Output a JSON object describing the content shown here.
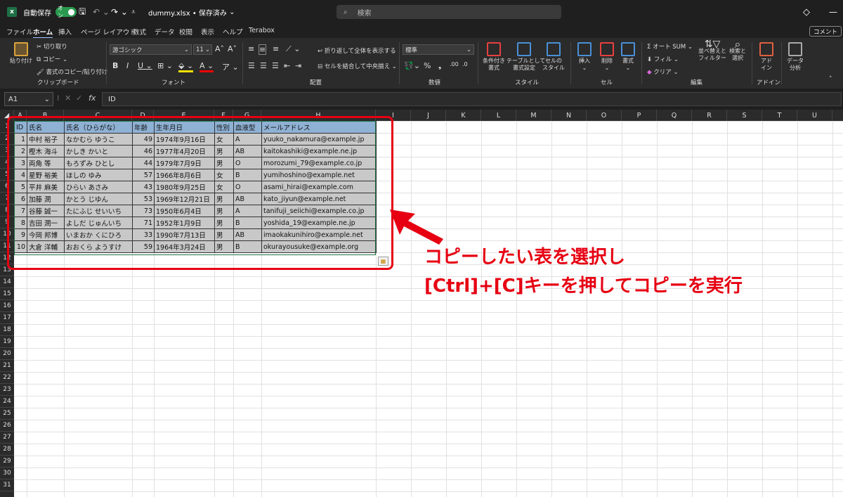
{
  "titlebar": {
    "autosave_label": "自動保存",
    "toggle_label": "オン",
    "file_name": "dummy.xlsx • 保存済み",
    "search_placeholder": "検索"
  },
  "tabs": [
    "ファイル",
    "ホーム",
    "挿入",
    "ページ レイアウト",
    "数式",
    "データ",
    "校閲",
    "表示",
    "ヘルプ",
    "Terabox"
  ],
  "share_label": "コメント",
  "ribbon": {
    "clipboard": {
      "paste": "貼り付け",
      "cut": "切り取り",
      "copy": "コピー",
      "format_painter": "書式のコピー/貼り付け",
      "label": "クリップボード"
    },
    "font": {
      "name": "游ゴシック",
      "size": "11",
      "label": "フォント"
    },
    "alignment": {
      "wrap": "折り返して全体を表示する",
      "merge": "セルを結合して中央揃え",
      "label": "配置"
    },
    "number": {
      "format": "標準",
      "label": "数値"
    },
    "styles": {
      "conditional": "条件付き\n書式",
      "table": "テーブルとして\n書式設定",
      "cell": "セルの\nスタイル",
      "label": "スタイル"
    },
    "cells": {
      "insert": "挿入",
      "delete": "削除",
      "format": "書式",
      "label": "セル"
    },
    "editing": {
      "autosum": "オート SUM",
      "fill": "フィル",
      "clear": "クリア",
      "sort": "並べ替えと\nフィルター",
      "find": "検索と\n選択",
      "label": "編集"
    },
    "addins": {
      "addin": "アド\nイン",
      "label": "アドイン"
    },
    "analysis": {
      "data": "データ\n分析"
    }
  },
  "namebox": "A1",
  "formula": "ID",
  "columns": [
    "A",
    "B",
    "C",
    "D",
    "E",
    "F",
    "G",
    "H",
    "I",
    "J",
    "K",
    "L",
    "M",
    "N",
    "O",
    "P",
    "Q",
    "R",
    "S",
    "T",
    "U"
  ],
  "table": {
    "headers": [
      "ID",
      "氏名",
      "氏名（ひらがな）",
      "年齢",
      "生年月日",
      "性別",
      "血液型",
      "メールアドレス"
    ],
    "rows": [
      [
        "1",
        "中村 裕子",
        "なかむら ゆうこ",
        "49",
        "1974年9月16日",
        "女",
        "A",
        "yuuko_nakamura@example.jp"
      ],
      [
        "2",
        "樫木 海斗",
        "かしき かいと",
        "46",
        "1977年4月20日",
        "男",
        "AB",
        "kaitokashiki@example.ne.jp"
      ],
      [
        "3",
        "両角 等",
        "もろずみ ひとし",
        "44",
        "1979年7月9日",
        "男",
        "O",
        "morozumi_79@example.co.jp"
      ],
      [
        "4",
        "星野 裕美",
        "ほしの ゆみ",
        "57",
        "1966年8月6日",
        "女",
        "B",
        "yumihoshino@example.net"
      ],
      [
        "5",
        "平井 麻美",
        "ひらい あさみ",
        "43",
        "1980年9月25日",
        "女",
        "O",
        "asami_hirai@example.com"
      ],
      [
        "6",
        "加藤 潤",
        "かとう じゆん",
        "53",
        "1969年12月21日",
        "男",
        "AB",
        "kato_jiyun@example.net"
      ],
      [
        "7",
        "谷藤 誠一",
        "たにふじ せいいち",
        "73",
        "1950年6月4日",
        "男",
        "A",
        "tanifuji_seiichi@example.co.jp"
      ],
      [
        "8",
        "吉田 潤一",
        "よしだ じゅんいち",
        "71",
        "1952年1月9日",
        "男",
        "B",
        "yoshida_19@example.ne.jp"
      ],
      [
        "9",
        "今岡 邦博",
        "いまおか くにひろ",
        "33",
        "1990年7月13日",
        "男",
        "AB",
        "imaokakunihiro@example.net"
      ],
      [
        "10",
        "大倉 洋輔",
        "おおくら ようすけ",
        "59",
        "1964年3月24日",
        "男",
        "B",
        "okurayousuke@example.org"
      ]
    ]
  },
  "row_numbers": [
    "1",
    "2",
    "3",
    "4",
    "5",
    "6",
    "7",
    "8",
    "9",
    "10",
    "11",
    "12",
    "13",
    "14",
    "15",
    "16",
    "17",
    "18",
    "19",
    "20",
    "21",
    "22",
    "23",
    "24",
    "25",
    "26",
    "27",
    "28",
    "29",
    "30",
    "31"
  ],
  "annotation": {
    "line1": "コピーしたい表を選択し",
    "line2": "[Ctrl]+[C]キーを押してコピーを実行",
    "color": "#e60012"
  }
}
